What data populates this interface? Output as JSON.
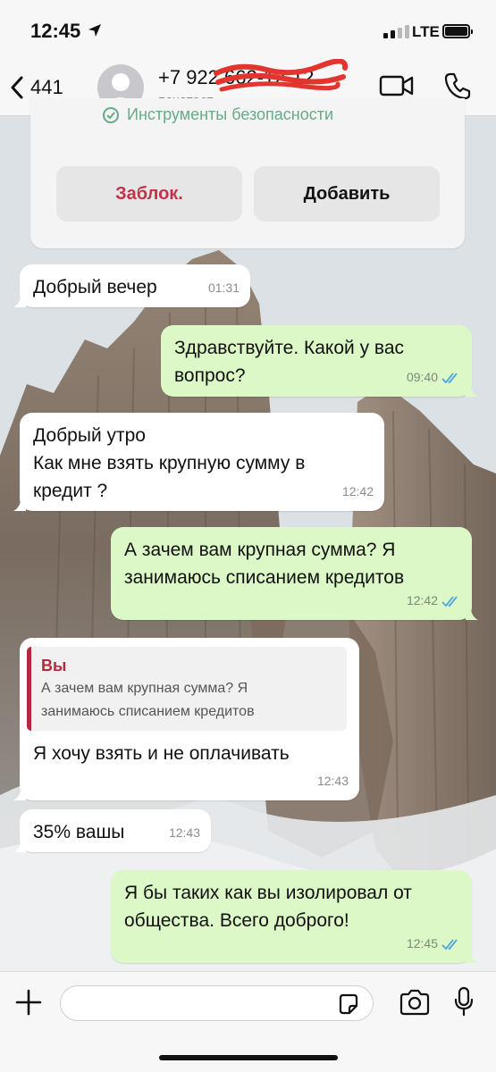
{
  "status_bar": {
    "time": "12:45",
    "network": "LTE"
  },
  "header": {
    "back_count": "441",
    "contact_name": "+7 922 662-12-12",
    "contact_status": "печатает..."
  },
  "contact_card": {
    "security_text": "Инструменты безопасности",
    "block_label": "Заблок.",
    "add_label": "Добавить"
  },
  "messages": [
    {
      "direction": "in",
      "text": "Добрый вечер",
      "time": "01:31"
    },
    {
      "direction": "out",
      "text": "Здравствуйте. Какой у вас\nвопрос?",
      "time": "09:40",
      "read": true
    },
    {
      "direction": "in",
      "text": "Добрый утро\nКак мне взять крупную сумму в\nкредит ?",
      "time": "12:42"
    },
    {
      "direction": "out",
      "text": "А зачем вам крупная сумма? Я\nзанимаюсь списанием кредитов",
      "time": "12:42",
      "read": true
    },
    {
      "direction": "in",
      "quote": {
        "author": "Вы",
        "text": "А зачем вам крупная сумма? Я\nзанимаюсь списанием кредитов"
      },
      "text": "Я хочу взять и не оплачивать",
      "time": "12:43"
    },
    {
      "direction": "in",
      "text": "35% вашы",
      "time": "12:43"
    },
    {
      "direction": "out",
      "text": "Я бы таких как вы изолировал от\nобщества. Всего доброго!",
      "time": "12:45",
      "read": true
    }
  ],
  "input": {
    "placeholder": ""
  },
  "icons": {
    "back": "chevron-left-icon",
    "video": "video-camera-icon",
    "phone": "phone-icon",
    "plus": "plus-icon",
    "sticker": "sticker-icon",
    "camera": "camera-icon",
    "mic": "microphone-icon",
    "read": "double-check-icon"
  },
  "colors": {
    "outgoing_bubble": "#dcf8c6",
    "incoming_bubble": "#ffffff",
    "read_ticks": "#4fa3e0",
    "block_red": "#c0344a",
    "quote_accent": "#b5283f"
  }
}
